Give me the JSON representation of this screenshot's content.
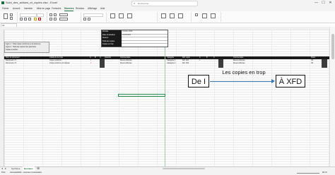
{
  "window": {
    "title": "Suivi_des_actions_et_copies.xlsx  -  Excel",
    "search_placeholder": "Rechercher",
    "minimize": "—",
    "maximize": "☐",
    "close": "✕"
  },
  "ribbon_tabs": [
    "Fichier",
    "Accueil",
    "Insertion",
    "Mise en page",
    "Formules",
    "Données",
    "Révision",
    "Affichage",
    "Aide"
  ],
  "active_tab_index": 5,
  "formula_bar": {
    "name_box": "A1"
  },
  "info_box": {
    "rows": [
      {
        "label": "Période",
        "value": "Octobre 2024"
      },
      {
        "label": "Date d'extraction",
        "value": "12/10/2024"
      },
      {
        "label": "Secteur",
        "value": ""
      },
      {
        "label": "Total des copies",
        "value": ""
      },
      {
        "label": "Copies en trop",
        "value": ""
      }
    ]
  },
  "note_box": {
    "lines": [
      "Ligne 1 : Total copies conformes à la référence",
      "Ligne 2 : Total des copies hors périmètre",
      "Copies à vérifier"
    ]
  },
  "table_left": {
    "headers": [
      "Nom du document",
      "Libellé de la copie",
      "A",
      "B",
      "C",
      "Quantité",
      "Commentaire"
    ],
    "rows": [
      [
        "Document n°1",
        "Copie conforme",
        "1",
        "",
        "",
        "",
        "Renvoi effectué"
      ],
      [
        "Document n°2",
        "Copie conforme à l'original",
        "1",
        "",
        "",
        "",
        "Renvoi effectué"
      ]
    ]
  },
  "table_right": {
    "headers": [
      "Catégorie",
      "Réf. copie",
      "A",
      "B",
      "C",
      "Commentaire",
      "Statut"
    ],
    "rows": [
      [
        "Catégorie 1",
        "Réf. 001",
        "1",
        "",
        "",
        "Renvoi effectué",
        "OK"
      ],
      [
        "Catégorie 2",
        "Réf. 002",
        "",
        "",
        "",
        "Renvoi effectué",
        "OK"
      ]
    ]
  },
  "annotation": {
    "from_label": "De I",
    "to_label": "À XFD",
    "arrow_label": "Les copies en trop"
  },
  "sheet_tabs": [
    "Synthèse",
    "Données"
  ],
  "active_sheet_index": 1,
  "status": {
    "left": "Prêt",
    "accessibility": "Accessibilité : examen nécessaire",
    "zoom": "60 %"
  },
  "colors": {
    "excel_green": "#1e6b3c",
    "header_black": "#1a1a1a",
    "red_flag": "#d31c1c",
    "arrow_blue": "#3c78b5"
  }
}
